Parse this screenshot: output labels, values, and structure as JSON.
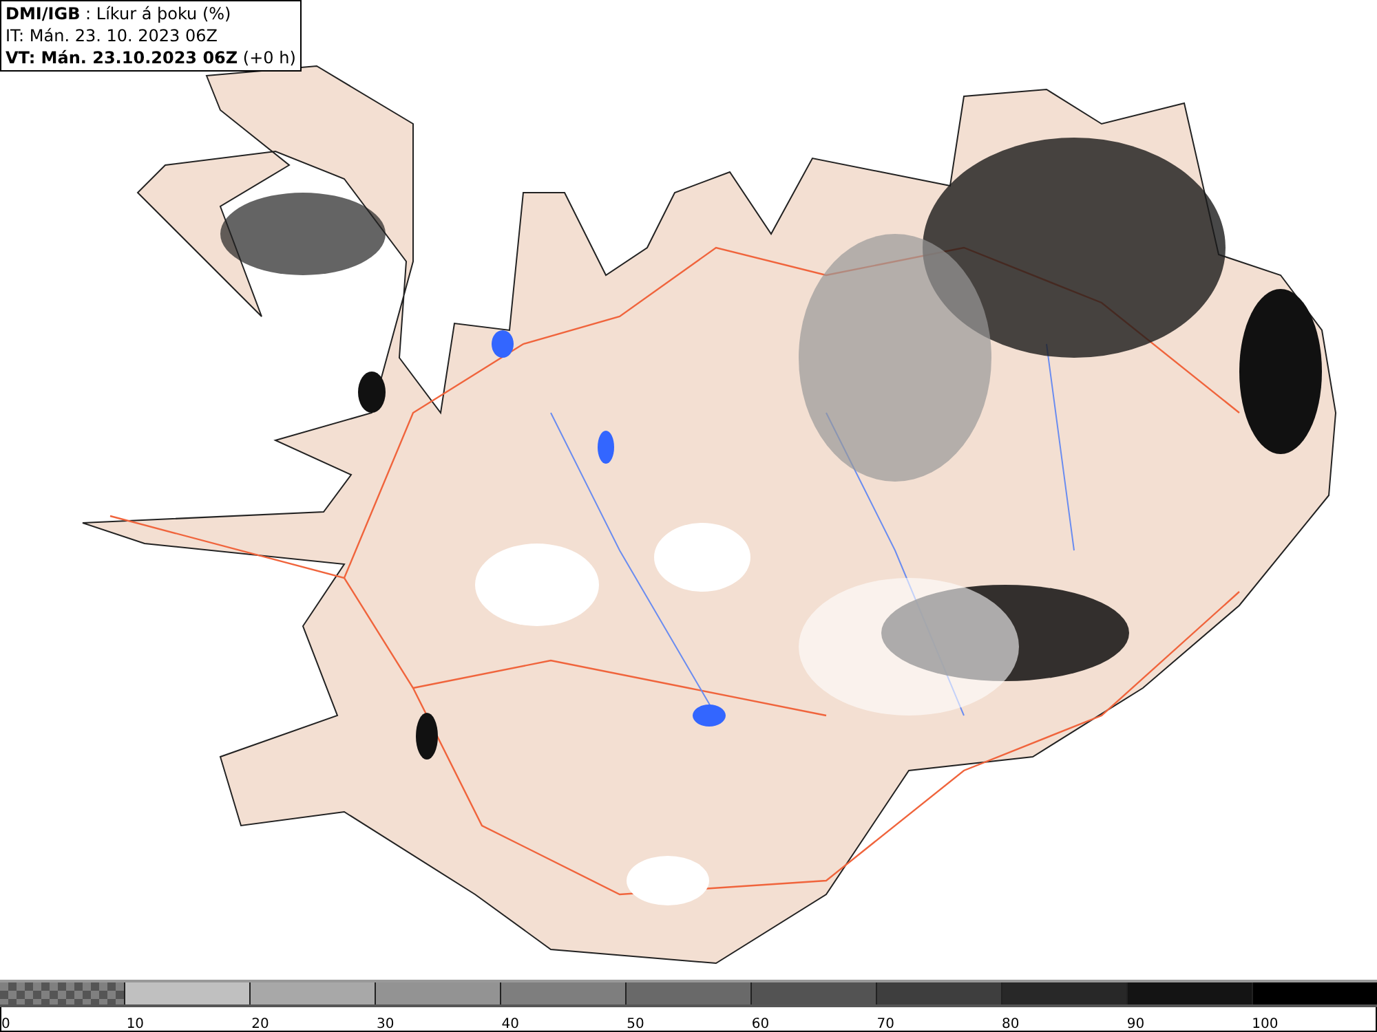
{
  "title_box": {
    "lines": [
      "**DMI/IGB** : Líkur á þoku (%)",
      "IT: Mán. 23. 10. 2023 06Z",
      "**VT: Mán. 23.10.2023 06Z** (+0 h)"
    ]
  },
  "legend": {
    "segments": [
      {
        "kind": "checker",
        "color": "#808080"
      },
      {
        "kind": "solid",
        "color": "#c0c0c0"
      },
      {
        "kind": "solid",
        "color": "#a8a8a8"
      },
      {
        "kind": "solid",
        "color": "#939393"
      },
      {
        "kind": "solid",
        "color": "#7e7e7e"
      },
      {
        "kind": "solid",
        "color": "#696969"
      },
      {
        "kind": "solid",
        "color": "#535353"
      },
      {
        "kind": "solid",
        "color": "#3e3e3e"
      },
      {
        "kind": "solid",
        "color": "#282828"
      },
      {
        "kind": "solid",
        "color": "#141414"
      },
      {
        "kind": "solid",
        "color": "#000000"
      }
    ],
    "ticks": [
      "0",
      "10",
      "20",
      "30",
      "40",
      "50",
      "60",
      "70",
      "80",
      "90",
      "100"
    ]
  }
}
